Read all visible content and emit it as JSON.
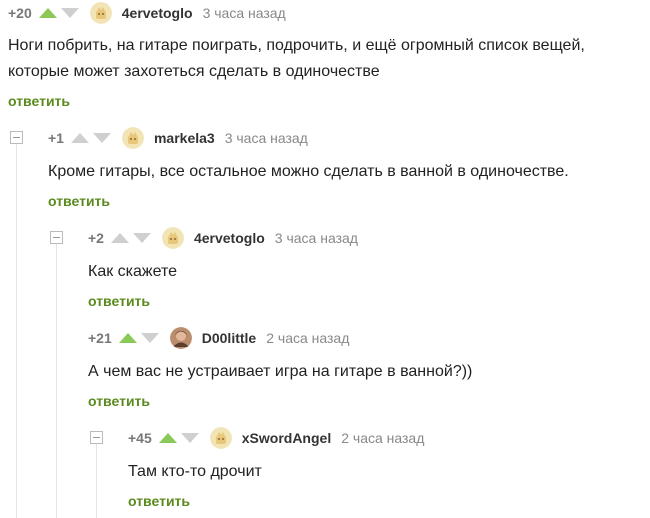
{
  "comments": [
    {
      "score": "+20",
      "author": "4ervetoglo",
      "time": "3 часа назад",
      "text_lines": [
        "Ноги побрить, на гитаре поиграть, подрочить, и ещё огромный список вещей,",
        "которые может захотеться сделать в одиночестве"
      ],
      "reply": "ответить",
      "vote": "up",
      "avatar": "placeholder"
    },
    {
      "score": "+1",
      "author": "markela3",
      "time": "3 часа назад",
      "text_lines": [
        "Кроме гитары, все остальное можно сделать в ванной в одиночестве."
      ],
      "reply": "ответить",
      "vote": "none",
      "avatar": "placeholder"
    },
    {
      "score": "+2",
      "author": "4ervetoglo",
      "time": "3 часа назад",
      "text_lines": [
        "Как скажете"
      ],
      "reply": "ответить",
      "vote": "none",
      "avatar": "placeholder"
    },
    {
      "score": "+21",
      "author": "D00little",
      "time": "2 часа назад",
      "text_lines": [
        "А чем вас не устраивает игра на гитаре в ванной?))"
      ],
      "reply": "ответить",
      "vote": "up",
      "avatar": "photo"
    },
    {
      "score": "+45",
      "author": "xSwordAngel",
      "time": "2 часа назад",
      "text_lines": [
        "Там кто-то дрочит"
      ],
      "reply": "ответить",
      "vote": "up",
      "avatar": "placeholder"
    }
  ],
  "colors": {
    "accent_green": "#5a8a1e",
    "arrow_up_active": "#8ac858",
    "arrow_inactive": "#cfcfcf",
    "avatar_placeholder": "#f2e4b5",
    "thread_line": "#e3e3e3"
  },
  "icons": {
    "upvote": "triangle-up-icon",
    "downvote": "triangle-down-icon",
    "collapse": "minus-box-icon"
  }
}
